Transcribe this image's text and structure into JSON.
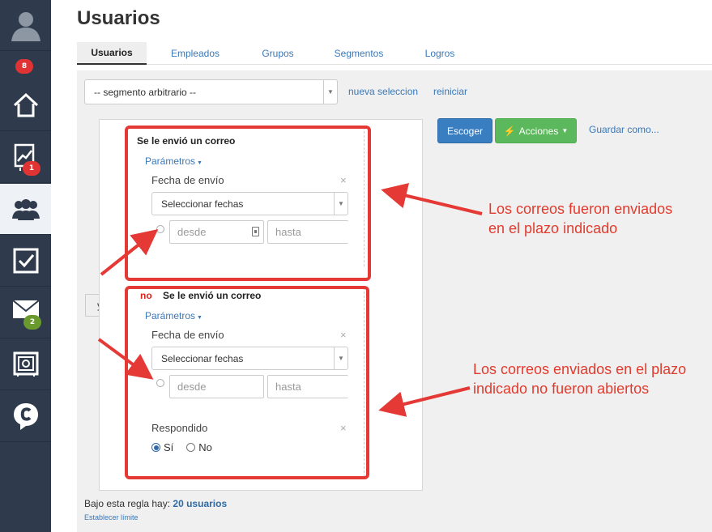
{
  "sidebar": {
    "items": [
      {
        "name": "avatar",
        "badge": "8",
        "badge_color": "#e03434"
      },
      {
        "name": "home-icon"
      },
      {
        "name": "analytics-icon",
        "badge": "1",
        "badge_color": "#e03434"
      },
      {
        "name": "users-icon",
        "active": true
      },
      {
        "name": "checkbox-icon"
      },
      {
        "name": "mail-icon",
        "badge": "2",
        "badge_color": "#6a9a2e"
      },
      {
        "name": "safe-icon"
      },
      {
        "name": "chat-logo-icon"
      }
    ]
  },
  "page_title": "Usuarios",
  "tabs": [
    "Usuarios",
    "Empleados",
    "Grupos",
    "Segmentos",
    "Logros"
  ],
  "segment": {
    "value": "-- segmento arbitrario --",
    "new_link": "nueva seleccion",
    "reset_link": "reiniciar"
  },
  "rule1": {
    "title": "Se le envió un correo",
    "params": "Parámetros",
    "field_label": "Fecha de envío",
    "select_value": "Seleccionar fechas",
    "from_placeholder": "desde",
    "to_placeholder": "hasta"
  },
  "connector": "y",
  "rule2": {
    "negation": "no",
    "title": "Se le envió un correo",
    "params": "Parámetros",
    "field_label": "Fecha de envío",
    "select_value": "Seleccionar fechas",
    "from_placeholder": "desde",
    "to_placeholder": "hasta",
    "responded_label": "Respondido",
    "yes_label": "Sí",
    "no_label": "No"
  },
  "actions": {
    "choose": "Escoger",
    "actions": "Acciones",
    "save_as": "Guardar como..."
  },
  "summary": {
    "prefix": "Bajo esta regla hay:",
    "count": "20 usuarios",
    "limit_link": "Establecer límite"
  },
  "annotations": {
    "note1_line1": "Los correos fueron enviados",
    "note1_line2": "en el plazo indicado",
    "note2_line1": "Los correos enviados en el plazo",
    "note2_line2": "indicado no fueron abiertos"
  },
  "colors": {
    "annotation": "#e23b2e",
    "sidebar": "#2f3b4c",
    "link": "#3a78b8"
  }
}
